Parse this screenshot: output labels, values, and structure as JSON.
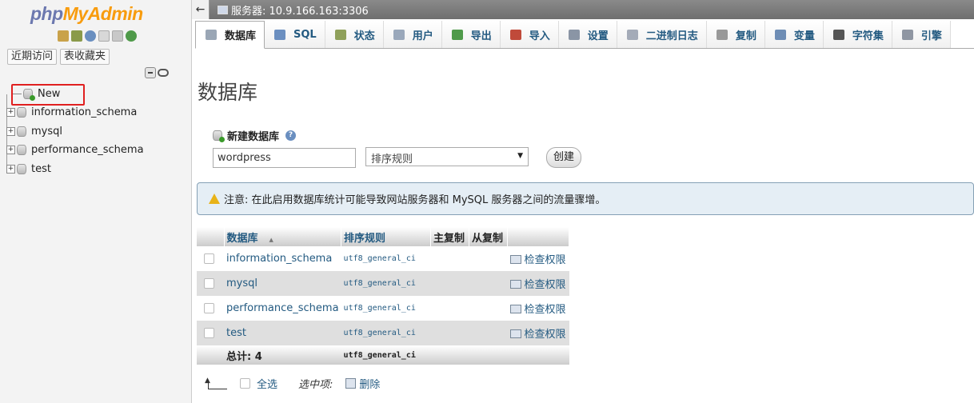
{
  "nav": {
    "logo_php": "php",
    "logo_admin": "MyAdmin",
    "recent_label": "近期访问",
    "favorites_label": "表收藏夹",
    "tree": [
      {
        "label": "New",
        "type": "new"
      },
      {
        "label": "information_schema",
        "type": "db"
      },
      {
        "label": "mysql",
        "type": "db"
      },
      {
        "label": "performance_schema",
        "type": "db"
      },
      {
        "label": "test",
        "type": "db"
      }
    ]
  },
  "serverbar": {
    "back": "←",
    "server_label": "服务器: 10.9.166.163:3306"
  },
  "tabs": [
    {
      "label": "数据库",
      "icon": "database-icon",
      "color": "#9aa6b5"
    },
    {
      "label": "SQL",
      "icon": "sql-icon",
      "color": "#6b8fc0"
    },
    {
      "label": "状态",
      "icon": "status-icon",
      "color": "#8fa05a"
    },
    {
      "label": "用户",
      "icon": "users-icon",
      "color": "#9aa8bb"
    },
    {
      "label": "导出",
      "icon": "export-icon",
      "color": "#4f9a4a"
    },
    {
      "label": "导入",
      "icon": "import-icon",
      "color": "#c04a3a"
    },
    {
      "label": "设置",
      "icon": "wrench-icon",
      "color": "#8a95a5"
    },
    {
      "label": "二进制日志",
      "icon": "binlog-icon",
      "color": "#a4abb8"
    },
    {
      "label": "复制",
      "icon": "replication-icon",
      "color": "#999999"
    },
    {
      "label": "变量",
      "icon": "variables-icon",
      "color": "#6e8db5"
    },
    {
      "label": "字符集",
      "icon": "charset-icon",
      "color": "#555555"
    },
    {
      "label": "引擎",
      "icon": "engine-icon",
      "color": "#8f96a2"
    }
  ],
  "main": {
    "title": "数据库",
    "create_label": "新建数据库",
    "db_name_value": "wordpress",
    "collation_placeholder": "排序规则",
    "create_button": "创建",
    "notice": "注意: 在此启用数据库统计可能导致网站服务器和 MySQL 服务器之间的流量骤增。"
  },
  "table": {
    "headers": {
      "database": "数据库",
      "sort_indicator": "▲",
      "collation": "排序规则",
      "master": "主复制",
      "slave": "从复制"
    },
    "rows": [
      {
        "name": "information_schema",
        "collation": "utf8_general_ci",
        "action": "检查权限"
      },
      {
        "name": "mysql",
        "collation": "utf8_general_ci",
        "action": "检查权限"
      },
      {
        "name": "performance_schema",
        "collation": "utf8_general_ci",
        "action": "检查权限"
      },
      {
        "name": "test",
        "collation": "utf8_general_ci",
        "action": "检查权限"
      }
    ],
    "total_label": "总计: 4",
    "total_collation": "utf8_general_ci"
  },
  "bottom": {
    "select_all": "全选",
    "with_selected": "选中项:",
    "delete": "删除"
  }
}
